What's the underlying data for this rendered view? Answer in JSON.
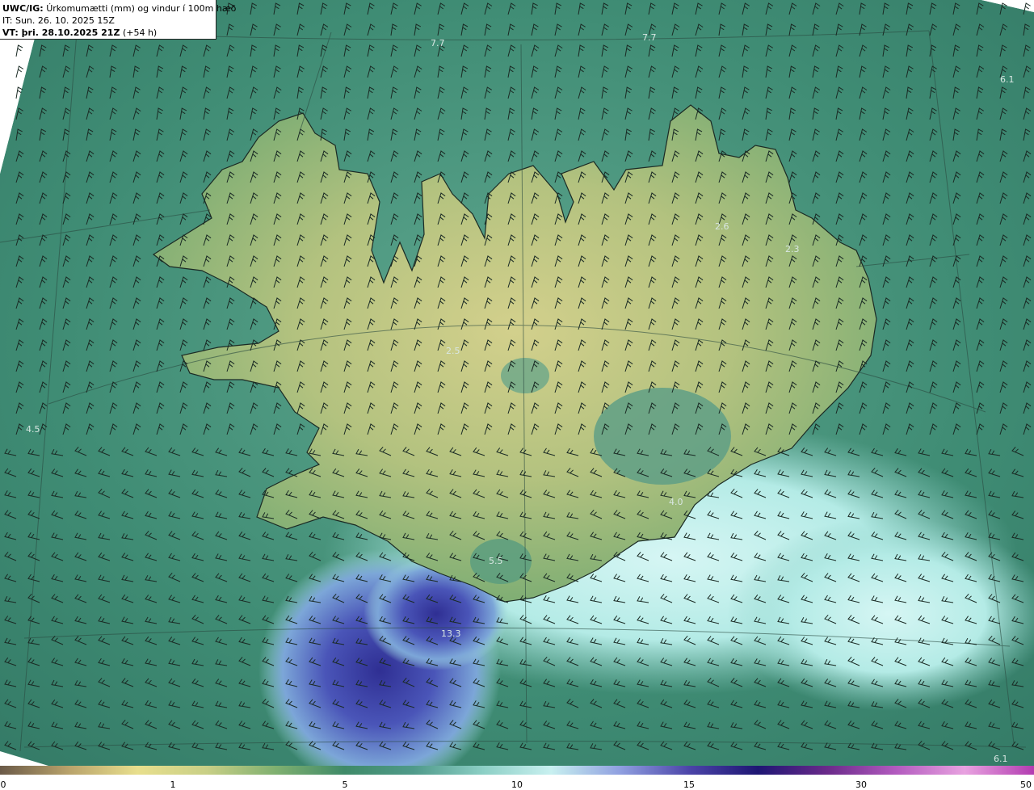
{
  "header": {
    "product_code": "UWC/IG:",
    "product_title": "Úrkomumætti (mm) og vindur í 100m hæð",
    "initial_time": "IT: Sun. 26. 10. 2025 15Z",
    "valid_time_label": "VT: þri. 28.10.2025 21Z",
    "lead_time": "(+54 h)"
  },
  "map_labels": [
    {
      "text": "7.7"
    },
    {
      "text": "7.7"
    },
    {
      "text": "6.1"
    },
    {
      "text": "2.6"
    },
    {
      "text": "2.3"
    },
    {
      "text": "2.5"
    },
    {
      "text": "4.5"
    },
    {
      "text": "4.0"
    },
    {
      "text": "5.5"
    },
    {
      "text": "13.3"
    },
    {
      "text": "6.1"
    }
  ],
  "colorbar": {
    "ticks": [
      "0",
      "1",
      "5",
      "10",
      "15",
      "30",
      "50"
    ],
    "colors": [
      "#6b5a48",
      "#b9a36b",
      "#e8df8d",
      "#c8cf86",
      "#7fb070",
      "#3f8a68",
      "#4f9a8a",
      "#8ccfc5",
      "#c8f0f0",
      "#8f9fe0",
      "#4b44a8",
      "#1e1673",
      "#6a2a8a",
      "#b35bbf",
      "#e8a2e0",
      "#b23bb0"
    ]
  },
  "theme": {
    "sea_color": "#3d8a76",
    "land_color": "#a9c07c",
    "highland_color": "#cfd08a",
    "heavy_precip_color": "#4b4fb0",
    "moderate_precip_color": "#b8ecea"
  },
  "icons": [
    "wind-barb-icon",
    "colorbar-legend"
  ]
}
